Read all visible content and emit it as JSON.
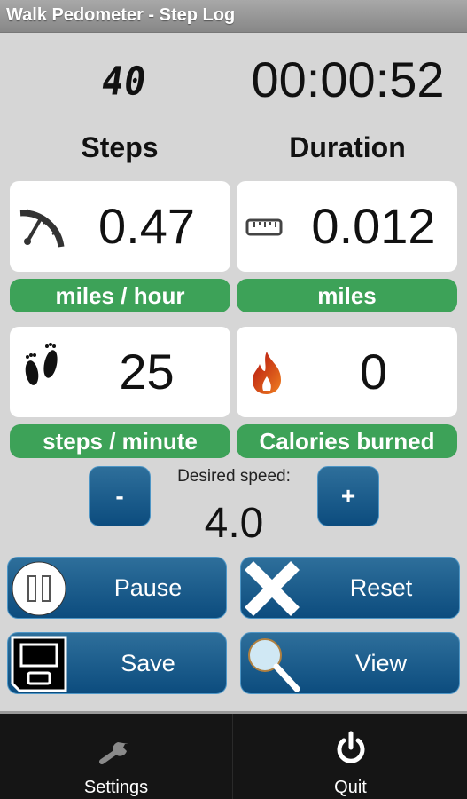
{
  "app": {
    "title": "Walk Pedometer - Step Log"
  },
  "summary": {
    "steps_value": "40",
    "duration_value": "00:00:52",
    "steps_heading": "Steps",
    "duration_heading": "Duration"
  },
  "stats": [
    {
      "icon": "speedometer-icon",
      "value": "0.47",
      "unit": "miles / hour"
    },
    {
      "icon": "ruler-icon",
      "value": "0.012",
      "unit": "miles"
    },
    {
      "icon": "footprints-icon",
      "value": "25",
      "unit": "steps / minute"
    },
    {
      "icon": "flame-icon",
      "value": "0",
      "unit": "Calories burned"
    }
  ],
  "speed": {
    "label": "Desired speed:",
    "value": "4.0",
    "decrease_label": "-",
    "increase_label": "+"
  },
  "actions": {
    "pause": "Pause",
    "reset": "Reset",
    "save": "Save",
    "view": "View"
  },
  "bottom_nav": {
    "settings": "Settings",
    "quit": "Quit"
  },
  "colors": {
    "accent_green": "#3da258",
    "button_blue": "#0c4c7e",
    "background": "#d6d6d6"
  }
}
